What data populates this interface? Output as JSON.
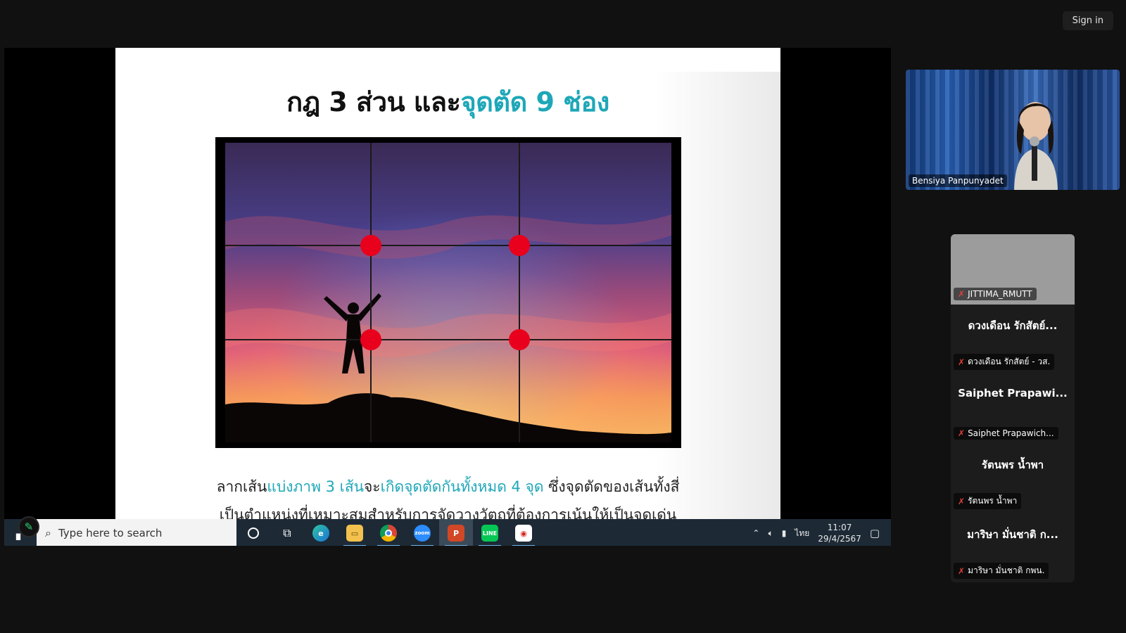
{
  "header": {
    "sign_in": "Sign in"
  },
  "slide": {
    "title_part1": "กฎ 3 ส่วน และ",
    "title_part2": "จุดตัด 9 ช่อง",
    "body_line1_a": "ลากเส้น",
    "body_line1_b": "แบ่งภาพ 3 เส้น",
    "body_line1_c": "จะ",
    "body_line1_d": "เกิดจุดตัดกันทั้งหมด 4 จุด",
    "body_line1_e": " ซึ่งจุดตัดของเส้นทั้งสี่",
    "body_line2": "เป็นตำแหน่งที่เหมาะสมสำหรับการจัดวางวัตถุที่ต้องการเน้นให้เป็นจุดเด่น"
  },
  "taskbar": {
    "search_placeholder": "Type here to search",
    "apps": [
      "cortana-icon",
      "task-view-icon",
      "edge-icon",
      "file-explorer-icon",
      "chrome-icon",
      "zoom-icon",
      "powerpoint-icon",
      "line-icon",
      "acrobat-icon"
    ],
    "language": "ไทย",
    "time": "11:07",
    "date": "29/4/2567"
  },
  "speaker": {
    "name": "Bensiya Panpunyadet"
  },
  "participants": [
    {
      "big_name": "",
      "tag": "JITTIMA_RMUTT",
      "has_video": true
    },
    {
      "big_name": "ดวงเดือน รักสัตย์...",
      "tag": "ดวงเดือน รักสัตย์ - วส."
    },
    {
      "big_name": "Saiphet Prapawi...",
      "tag": "Saiphet Prapawich..."
    },
    {
      "big_name": "รัตนพร น้ำพา",
      "tag": "รัตนพร น้ำพา"
    },
    {
      "big_name": "มาริษา มั่นชาติ ก...",
      "tag": "มาริษา มั่นชาติ กพน."
    }
  ],
  "colors": {
    "accent": "#1ea7b8",
    "grid_point": "#e8001c",
    "mute": "#e0403a"
  }
}
